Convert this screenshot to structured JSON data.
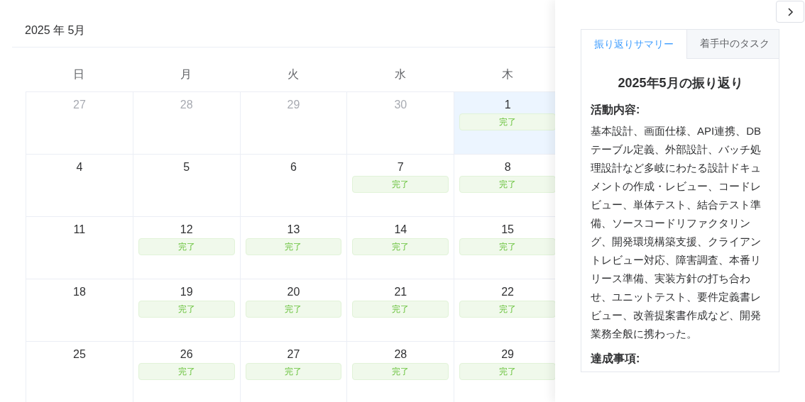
{
  "calendar": {
    "title": "2025 年 5月",
    "weekdays": [
      "日",
      "月",
      "火",
      "水",
      "木"
    ],
    "weeks": [
      [
        {
          "day": "27",
          "outside": true,
          "selected": false
        },
        {
          "day": "28",
          "outside": true,
          "selected": false
        },
        {
          "day": "29",
          "outside": true,
          "selected": false
        },
        {
          "day": "30",
          "outside": true,
          "selected": false
        },
        {
          "day": "1",
          "outside": false,
          "selected": true,
          "status": "完了"
        }
      ],
      [
        {
          "day": "4",
          "outside": false,
          "selected": false
        },
        {
          "day": "5",
          "outside": false,
          "selected": false
        },
        {
          "day": "6",
          "outside": false,
          "selected": false
        },
        {
          "day": "7",
          "outside": false,
          "selected": false,
          "status": "完了"
        },
        {
          "day": "8",
          "outside": false,
          "selected": false,
          "status": "完了"
        }
      ],
      [
        {
          "day": "11",
          "outside": false,
          "selected": false
        },
        {
          "day": "12",
          "outside": false,
          "selected": false,
          "status": "完了"
        },
        {
          "day": "13",
          "outside": false,
          "selected": false,
          "status": "完了"
        },
        {
          "day": "14",
          "outside": false,
          "selected": false,
          "status": "完了"
        },
        {
          "day": "15",
          "outside": false,
          "selected": false,
          "status": "完了"
        }
      ],
      [
        {
          "day": "18",
          "outside": false,
          "selected": false
        },
        {
          "day": "19",
          "outside": false,
          "selected": false,
          "status": "完了"
        },
        {
          "day": "20",
          "outside": false,
          "selected": false,
          "status": "完了"
        },
        {
          "day": "21",
          "outside": false,
          "selected": false,
          "status": "完了"
        },
        {
          "day": "22",
          "outside": false,
          "selected": false,
          "status": "完了"
        }
      ],
      [
        {
          "day": "25",
          "outside": false,
          "selected": false
        },
        {
          "day": "26",
          "outside": false,
          "selected": false,
          "status": "完了"
        },
        {
          "day": "27",
          "outside": false,
          "selected": false,
          "status": "完了"
        },
        {
          "day": "28",
          "outside": false,
          "selected": false,
          "status": "完了"
        },
        {
          "day": "29",
          "outside": false,
          "selected": false,
          "status": "完了"
        }
      ]
    ]
  },
  "drawer": {
    "tabs": [
      {
        "label": "振り返りサマリー",
        "selected": true
      },
      {
        "label": "着手中のタスク",
        "selected": false
      }
    ],
    "summary": {
      "title": "2025年5月の振り返り",
      "sections": [
        {
          "heading": "活動内容:",
          "body": "基本設計、画面仕様、API連携、DBテーブル定義、外部設計、バッチ処理設計など多岐にわたる設計ドキュメントの作成・レビュー、コードレビュー、単体テスト、結合テスト準備、ソースコードリファクタリング、開発環境構築支援、クライアントレビュー対応、障害調査、本番リリース準備、実装方針の打ち合わせ、ユニットテスト、要件定義書レビュー、改善提案書作成など、開発業務全般に携わった。"
        },
        {
          "heading": "達成事項:"
        }
      ]
    }
  }
}
